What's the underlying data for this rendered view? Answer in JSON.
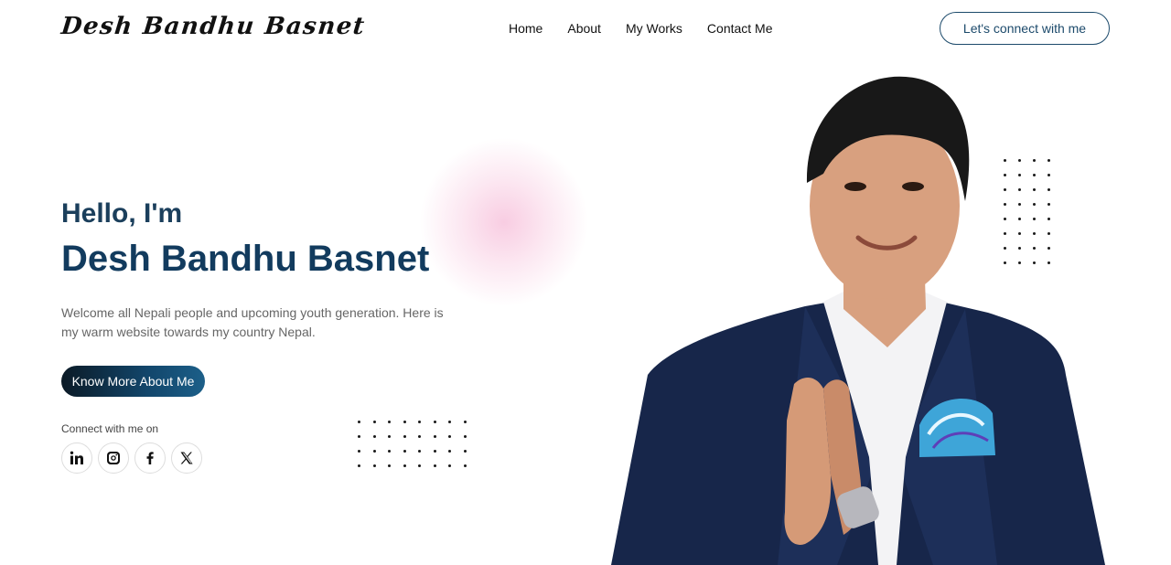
{
  "header": {
    "logo": "Desh Bandhu Basnet",
    "nav": [
      "Home",
      "About",
      "My Works",
      "Contact Me"
    ],
    "connect_button": "Let's connect with me"
  },
  "hero": {
    "greeting": "Hello, I'm",
    "name": "Desh Bandhu Basnet",
    "welcome": "Welcome all Nepali people and upcoming youth generation. Here is my warm website towards my country Nepal.",
    "cta": "Know More About Me",
    "connect_label": "Connect with me on",
    "socials": [
      "linkedin-icon",
      "instagram-icon",
      "facebook-icon",
      "x-icon"
    ]
  },
  "colors": {
    "primary": "#123b5e",
    "accent_border": "#1c4a6b",
    "glow": "#f7c4dd",
    "suit": "#17264a"
  }
}
